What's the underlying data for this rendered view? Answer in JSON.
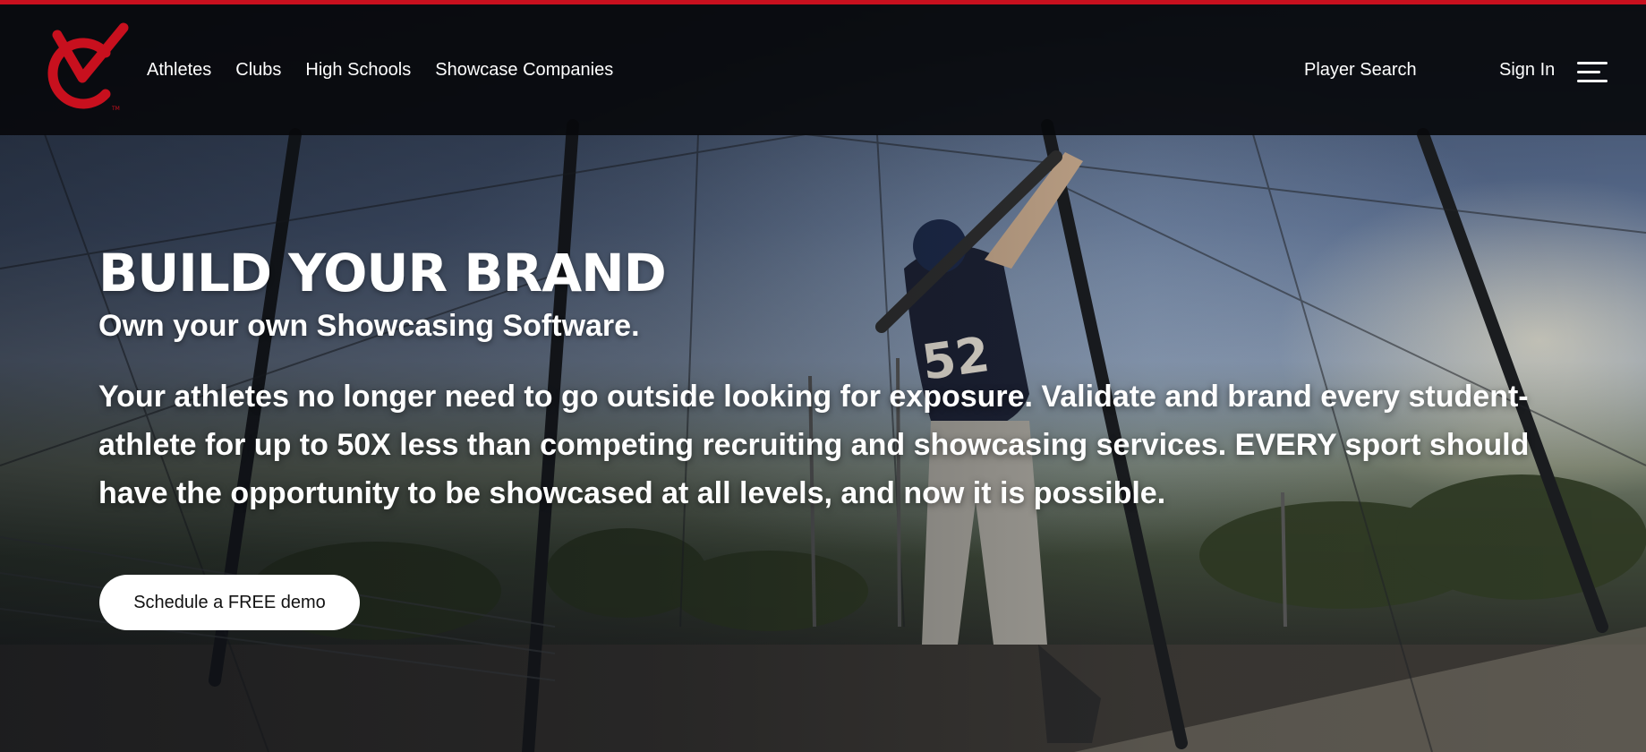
{
  "brand": {
    "accent": "#c8101e",
    "logo_name": "vc-monogram-logo"
  },
  "nav": {
    "items": [
      {
        "label": "Athletes"
      },
      {
        "label": "Clubs"
      },
      {
        "label": "High Schools"
      },
      {
        "label": "Showcase Companies"
      }
    ]
  },
  "header": {
    "player_search": "Player Search",
    "sign_in": "Sign In",
    "menu_icon": "hamburger-menu-icon"
  },
  "hero": {
    "title": "BUILD YOUR BRAND",
    "subtitle": "Own your own Showcasing Software.",
    "body": "Your athletes no longer need to go outside looking for exposure. Validate and brand every student-athlete for up to 50X less than competing recruiting and showcasing services. EVERY sport should have the opportunity to be showcased at all levels, and now it is possible.",
    "cta_label": "Schedule a FREE demo"
  }
}
